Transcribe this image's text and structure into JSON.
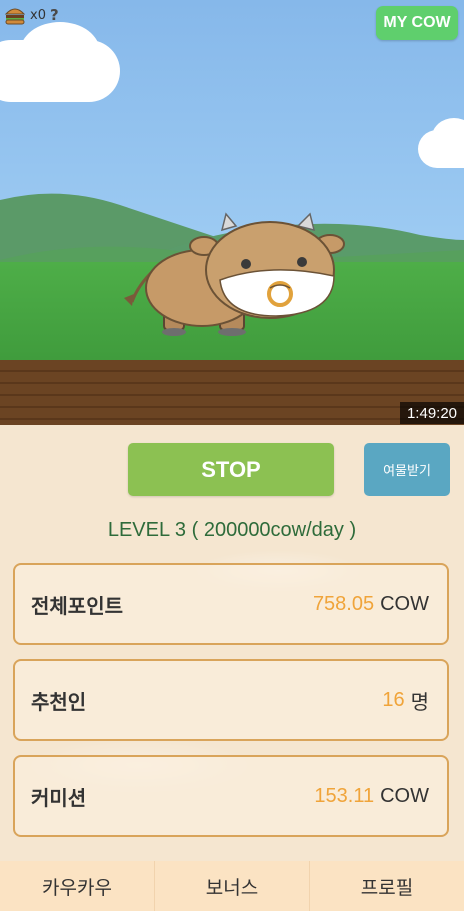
{
  "topbar": {
    "burger_count": "x0",
    "help_label": "?",
    "my_cow_label": "MY COW"
  },
  "scene": {
    "timer": "1:49:20"
  },
  "controls": {
    "stop_label": "STOP",
    "harvest_label": "여물받기"
  },
  "level": {
    "text": "LEVEL  3 ( 200000cow/day )"
  },
  "stats": [
    {
      "label": "전체포인트",
      "value": "758.05",
      "unit": "COW"
    },
    {
      "label": "추천인",
      "value": "16",
      "unit": "명"
    },
    {
      "label": "커미션",
      "value": "153.11",
      "unit": "COW"
    }
  ],
  "nav": {
    "items": [
      "카우카우",
      "보너스",
      "프로필"
    ]
  },
  "colors": {
    "stop_button": "#8cc152",
    "harvest_button": "#5aa7c2",
    "my_cow_button": "#5fcf6d",
    "value_highlight": "#f0a43a",
    "card_border": "#d9a45a"
  }
}
